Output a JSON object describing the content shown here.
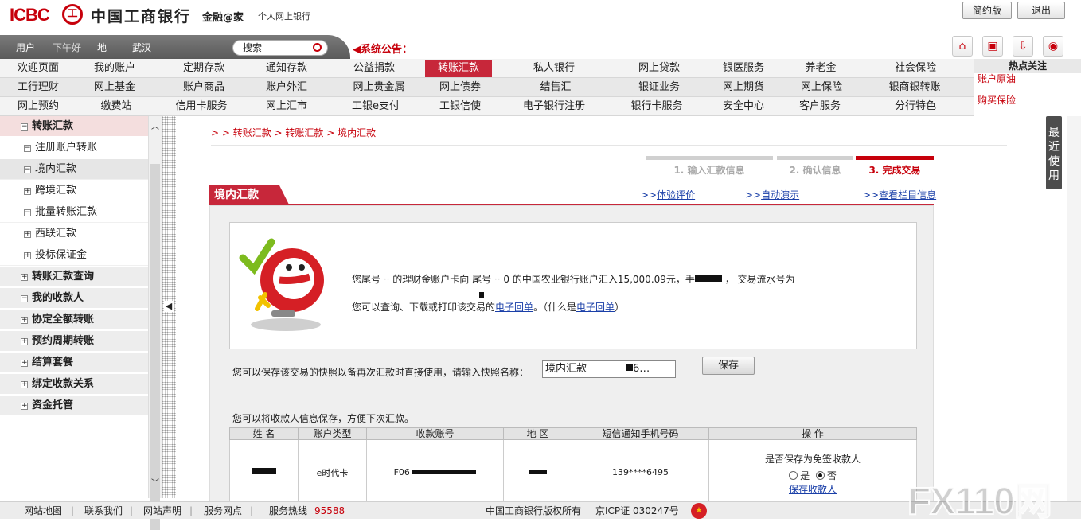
{
  "header": {
    "logo_en": "ICBC",
    "logo_cn": "中国工商银行",
    "slogan": "金融@家",
    "subtitle": "个人网上银行",
    "btn_simple": "简约版",
    "btn_logout": "退出"
  },
  "userbar": {
    "user": "用户",
    "user_value": "下午好",
    "region": "地",
    "region_value": "武汉",
    "search_placeholder": "搜索",
    "notice": "系统公告："
  },
  "menu": {
    "row0": [
      "欢迎页面",
      "我的账户",
      "定期存款",
      "通知存款",
      "公益捐款",
      "转账汇款",
      "私人银行",
      "网上贷款",
      "银医服务",
      "养老金",
      "社会保险"
    ],
    "row1": [
      "工行理财",
      "网上基金",
      "账户商品",
      "账户外汇",
      "网上贵金属",
      "网上债券",
      "结售汇",
      "银证业务",
      "网上期货",
      "网上保险",
      "银商银转账"
    ],
    "row2": [
      "网上预约",
      "缴费站",
      "信用卡服务",
      "网上汇市",
      "工银e支付",
      "工银信使",
      "电子银行注册",
      "银行卡服务",
      "安全中心",
      "客户服务",
      "分行特色"
    ],
    "active": "转账汇款"
  },
  "hot": {
    "title": "热点关注",
    "links": [
      "账户原油",
      "购买保险"
    ]
  },
  "sidebar": {
    "section": "转账汇款",
    "subs": [
      "注册账户转账",
      "境内汇款",
      "跨境汇款",
      "批量转账汇款",
      "西联汇款",
      "投标保证金"
    ],
    "others": [
      "转账汇款查询",
      "我的收款人",
      "协定全额转账",
      "预约周期转账",
      "结算套餐",
      "绑定收款关系",
      "资金托管"
    ]
  },
  "main": {
    "crumb": "> > 转账汇款 > 转账汇款 > 境内汇款",
    "steps": [
      "1. 输入汇款信息",
      "2. 确认信息",
      "3. 完成交易"
    ],
    "panel_title": "境内汇款",
    "link_eval": "体验评价",
    "link_demo": "自动演示",
    "link_info": "查看栏目信息",
    "msg_a": "您尾号",
    "msg_b": "的理财金账户卡向 尾号",
    "msg_c": "0 的中国农业银行账户汇入15,000.09元，手",
    "msg_d": "，  交易流水号为",
    "msg2_a": "您可以查询、下载或打印该交易的",
    "msg2_link": "电子回单",
    "msg2_b": "。（什么是",
    "msg2_link2": "电子回单",
    "msg2_c": "）",
    "save_prompt": "您可以保存该交易的快照以备再次汇款时直接使用，请输入快照名称：",
    "snapshot_value": "境内汇款",
    "snapshot_suffix": "6…",
    "save_btn": "保存",
    "payee_prompt": "您可以将收款人信息保存，方便下次汇款。",
    "table_headers": [
      "姓 名",
      "账户类型",
      "收款账号",
      "地 区",
      "短信通知手机号码",
      "操 作"
    ],
    "row": {
      "name": "",
      "type": "e时代卡",
      "account": "F06",
      "region": "",
      "phone": "139****6495",
      "op_label": "是否保存为免签收款人",
      "yes": "是",
      "no": "否",
      "save_payee": "保存收款人"
    }
  },
  "recent": "最近使用",
  "footer": {
    "links": [
      "网站地图",
      "联系我们",
      "网站声明",
      "服务网点"
    ],
    "hotline_label": "服务热线",
    "hotline": "95588",
    "copyright": "中国工商银行版权所有",
    "icp": "京ICP证 030247号"
  },
  "watermark": "FX110网"
}
